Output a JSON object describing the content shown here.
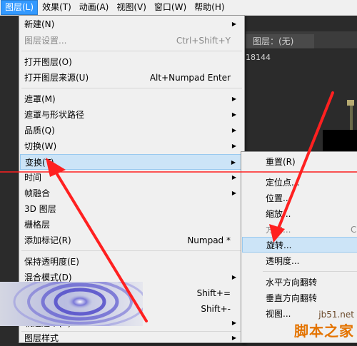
{
  "menubar": [
    {
      "label": "图层(L)",
      "active": true
    },
    {
      "label": "效果(T)",
      "active": false
    },
    {
      "label": "动画(A)",
      "active": false
    },
    {
      "label": "视图(V)",
      "active": false
    },
    {
      "label": "窗口(W)",
      "active": false
    },
    {
      "label": "帮助(H)",
      "active": false
    }
  ],
  "background": {
    "layer_tab": "图层：(无)",
    "number": "18144"
  },
  "layer_menu": {
    "new": {
      "label": "新建(N)"
    },
    "layer_settings": {
      "label": "图层设置...",
      "shortcut": "Ctrl+Shift+Y"
    },
    "open_layer": {
      "label": "打开图层(O)"
    },
    "open_layer_source": {
      "label": "打开图层来源(U)",
      "shortcut": "Alt+Numpad Enter"
    },
    "mask": {
      "label": "遮罩(M)"
    },
    "mask_shape_path": {
      "label": "遮罩与形状路径"
    },
    "quality": {
      "label": "品质(Q)"
    },
    "switches": {
      "label": "切换(W)"
    },
    "transform": {
      "label": "变换(T)"
    },
    "time": {
      "label": "时间"
    },
    "frame_blending": {
      "label": "帧融合"
    },
    "layer_3d": {
      "label": "3D 图层"
    },
    "guide_layer": {
      "label": "栅格层"
    },
    "add_marker": {
      "label": "添加标记(R)",
      "shortcut": "Numpad *"
    },
    "preserve_transparency": {
      "label": "保持透明度(E)"
    },
    "blending_mode": {
      "label": "混合模式(D)"
    },
    "next_blend_shortcut": "Shift+=",
    "prev_blend_shortcut": "Shift+-",
    "track_matte": {
      "label": "轨道遮罩(A)"
    },
    "layer_styles": {
      "label": "图层样式"
    }
  },
  "transform_menu": {
    "reset": "重置(R)",
    "anchor_point": "定位点...",
    "position": "位置...",
    "scale": "缩放...",
    "orientation": "方向...",
    "orientation_shortcut": "C",
    "rotation": "旋转...",
    "opacity": "透明度...",
    "flip_horizontal": "水平方向翻转",
    "flip_vertical": "垂直方向翻转",
    "center_in_view": "视图..."
  },
  "watermark": {
    "url": "jb51.net",
    "brand": "脚本之家"
  },
  "colors": {
    "menu_bg": "#f0f0f0",
    "highlight": "#cce4f7",
    "annotation": "#ff2020",
    "active_menubar": "#3399ff"
  }
}
